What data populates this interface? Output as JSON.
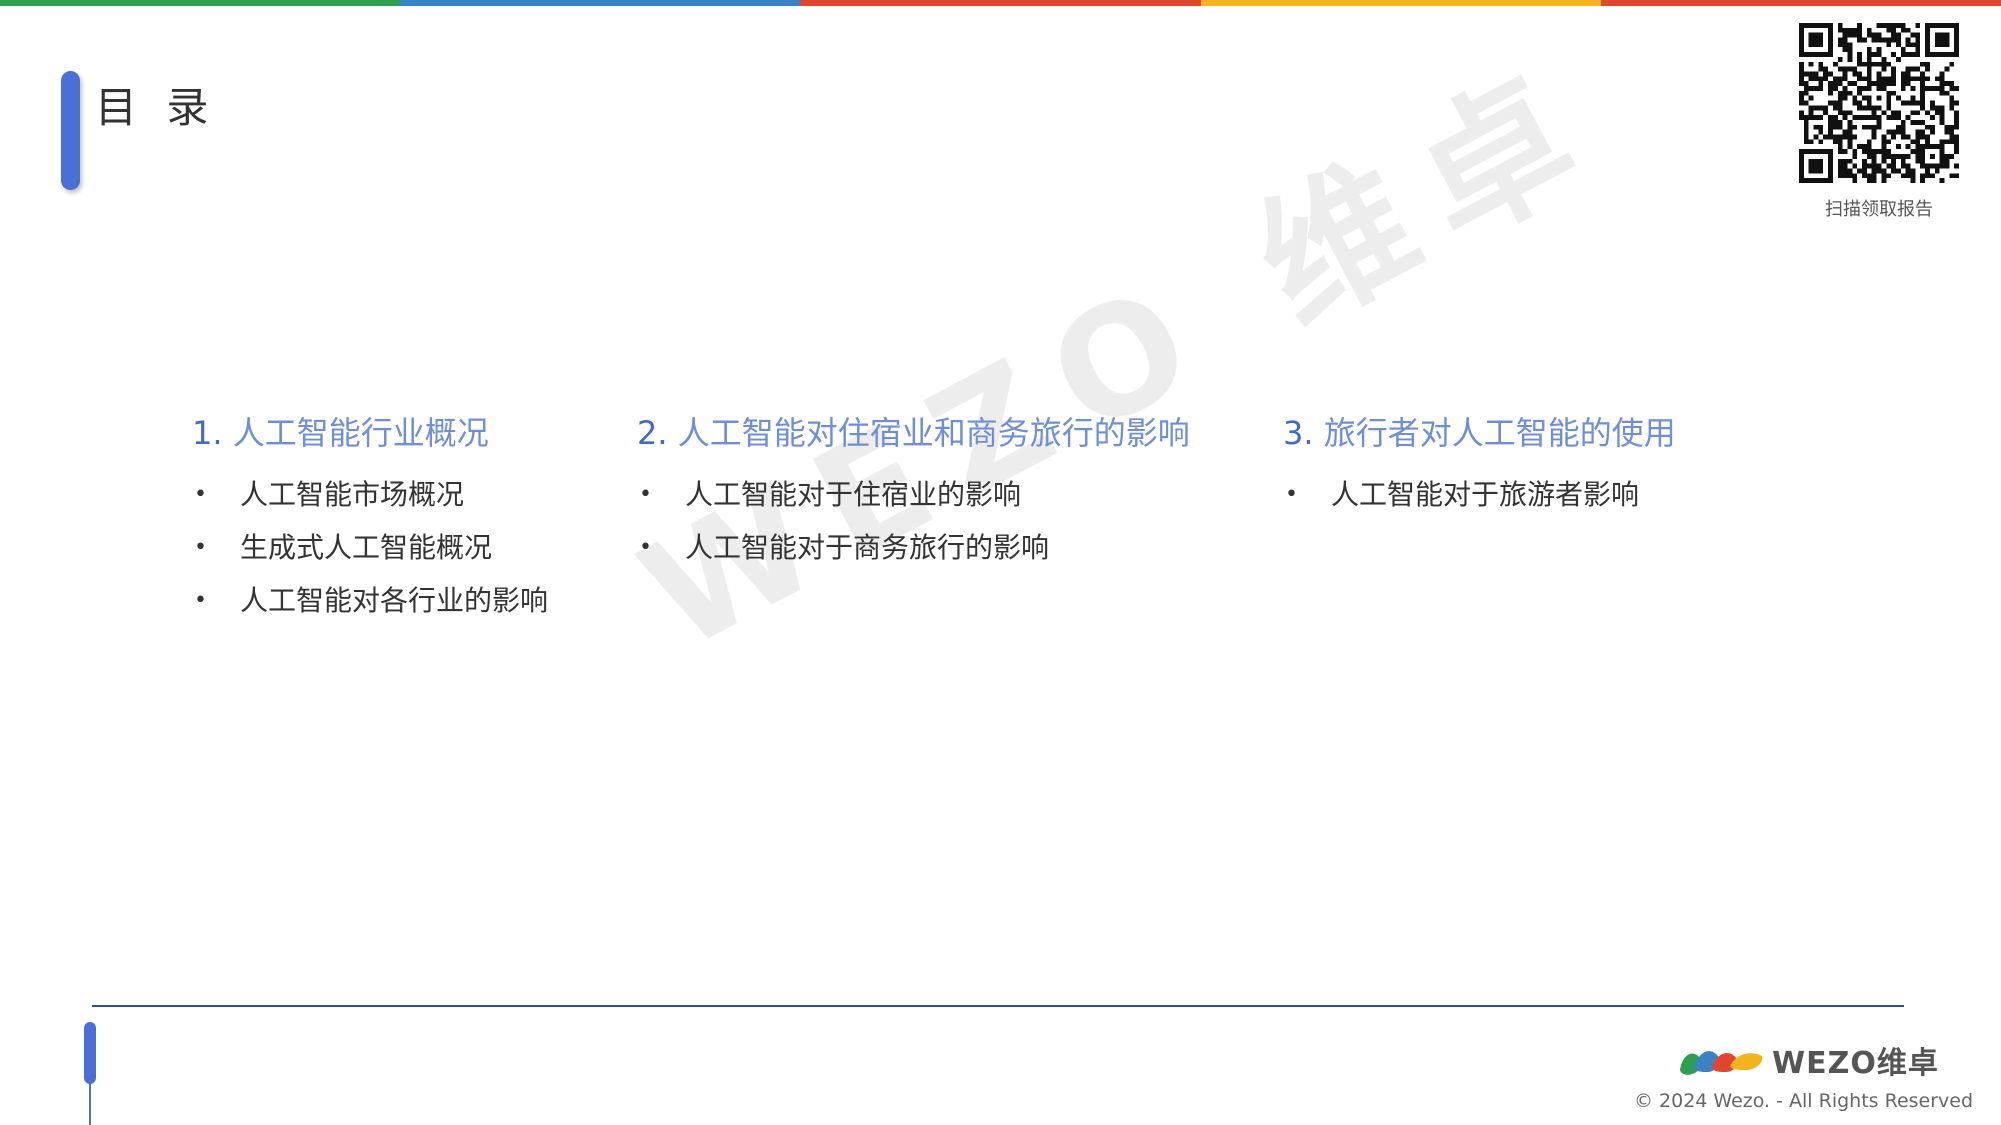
{
  "colors": {
    "top_stripe": [
      "#2f9e4f",
      "#3b82c4",
      "#e0452f",
      "#f2b41c",
      "#e0452f"
    ],
    "accent": "#4a6fd6",
    "heading": "#6e8ed8",
    "heading_number": "#4169c9",
    "rule": "#2e4f9e"
  },
  "header": {
    "title": "目 录"
  },
  "qr": {
    "icon": "qr-code-icon",
    "caption": "扫描领取报告"
  },
  "watermark": "WEZO 维卓",
  "toc": [
    {
      "number": "1.",
      "title": "人工智能行业概况",
      "items": [
        "人工智能市场概况",
        "生成式人工智能概况",
        "人工智能对各行业的影响"
      ]
    },
    {
      "number": "2.",
      "title": "人工智能对住宿业和商务旅行的影响",
      "items": [
        "人工智能对于住宿业的影响",
        "人工智能对于商务旅行的影响"
      ]
    },
    {
      "number": "3.",
      "title": "旅行者对人工智能的使用",
      "items": [
        "人工智能对于旅游者影响"
      ]
    }
  ],
  "bullet": "•",
  "footer": {
    "logo_icon": "wezo-logo-icon",
    "logo_text": "WEZO维卓",
    "copyright": "© 2024 Wezo. - All Rights Reserved"
  }
}
